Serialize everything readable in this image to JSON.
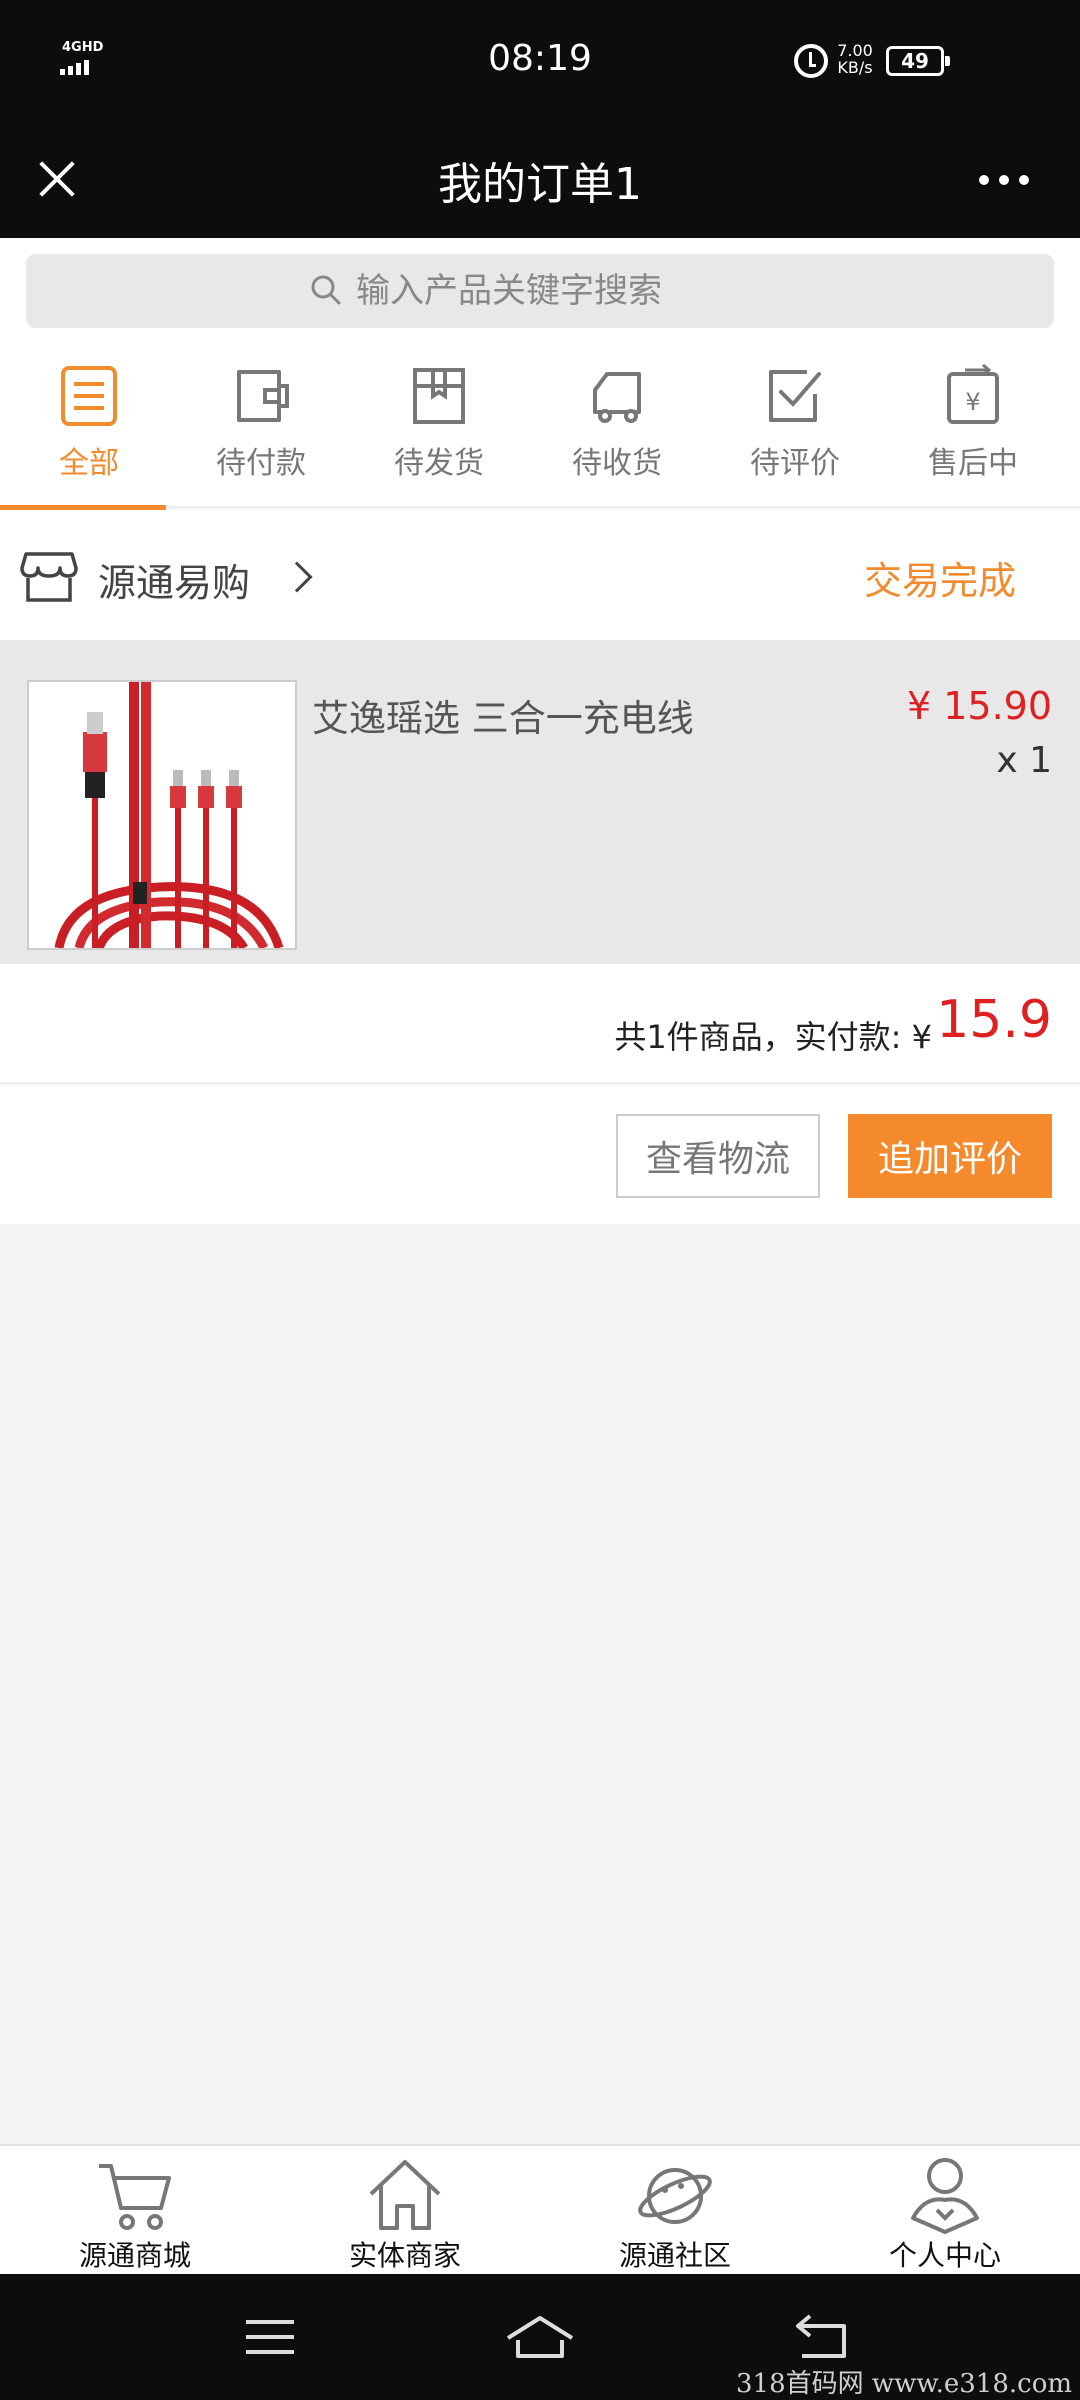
{
  "status_bar": {
    "network": "4GHD",
    "time": "08:19",
    "speed_value": "7.00",
    "speed_unit": "KB/s",
    "battery": "49"
  },
  "header": {
    "title": "我的订单1",
    "close_icon": "close-icon",
    "more_icon": "more-dots-icon"
  },
  "search": {
    "placeholder": "输入产品关键字搜索"
  },
  "tabs": [
    {
      "label": "全部",
      "icon": "list-icon",
      "active": true
    },
    {
      "label": "待付款",
      "icon": "wallet-icon",
      "active": false
    },
    {
      "label": "待发货",
      "icon": "package-icon",
      "active": false
    },
    {
      "label": "待收货",
      "icon": "truck-icon",
      "active": false
    },
    {
      "label": "待评价",
      "icon": "check-square-icon",
      "active": false
    },
    {
      "label": "售后中",
      "icon": "refund-icon",
      "active": false
    }
  ],
  "order": {
    "store_name": "源通易购",
    "status": "交易完成",
    "product": {
      "name": "艾逸瑶选 三合一充电线",
      "price": "¥ 15.90",
      "quantity": "x 1"
    },
    "summary_text": "共1件商品，实付款: ¥",
    "total": "15.9",
    "actions": {
      "logistics": "查看物流",
      "review": "追加评价"
    }
  },
  "bottom_nav": [
    {
      "label": "源通商城",
      "icon": "cart-icon"
    },
    {
      "label": "实体商家",
      "icon": "home-icon"
    },
    {
      "label": "源通社区",
      "icon": "planet-icon"
    },
    {
      "label": "个人中心",
      "icon": "user-icon"
    }
  ],
  "watermark": "318首码网 www.e318.com",
  "colors": {
    "accent": "#f28a2e",
    "price": "#e02020",
    "header_bg": "#0d0d0d"
  }
}
